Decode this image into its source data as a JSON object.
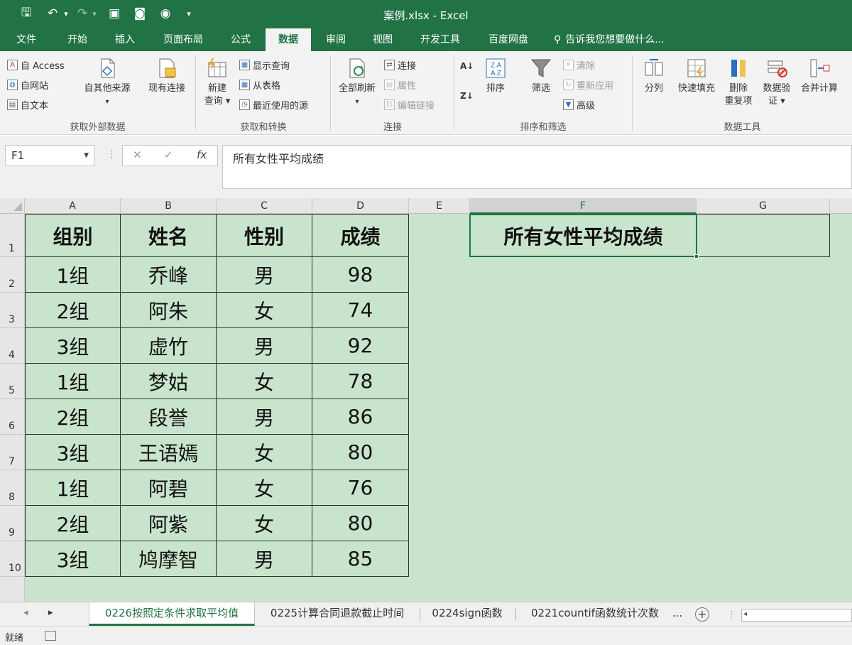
{
  "app": {
    "title": "案例.xlsx - Excel",
    "qat": {
      "save": "🖫",
      "undo": "↶",
      "undo_dd": "▾",
      "redo": "↷",
      "redo_dd": "▾",
      "extra": [
        "▣",
        "◙",
        "◉"
      ],
      "customize": "▾"
    }
  },
  "tabs": [
    "文件",
    "开始",
    "插入",
    "页面布局",
    "公式",
    "数据",
    "审阅",
    "视图",
    "开发工具",
    "百度网盘"
  ],
  "active_tab": "数据",
  "tell_me": "告诉我您想要做什么...",
  "ribbon": {
    "get_external": {
      "label": "获取外部数据",
      "items": [
        "自 Access",
        "自网站",
        "自文本"
      ],
      "other_sources": "自其他来源",
      "other_dd": "▾",
      "existing": "现有连接"
    },
    "transform": {
      "label": "获取和转换",
      "new_query": "新建",
      "new_query2": "查询 ▾",
      "items": [
        "显示查询",
        "从表格",
        "最近使用的源"
      ]
    },
    "connections": {
      "label": "连接",
      "refresh_all": "全部刷新",
      "refresh_dd": "▾",
      "items": [
        "连接",
        "属性",
        "编辑链接"
      ]
    },
    "sort_filter": {
      "label": "排序和筛选",
      "sort": "排序",
      "filter": "筛选",
      "items": [
        "清除",
        "重新应用",
        "高级"
      ]
    },
    "data_tools": {
      "label": "数据工具",
      "split": "分列",
      "flash_fill": "快速填充",
      "remove_dup": "删除",
      "remove_dup2": "重复项",
      "validation": "数据验",
      "validation2": "证 ▾",
      "consolidate": "合并计算"
    }
  },
  "formula_bar": {
    "name_box": "F1",
    "cancel": "✕",
    "enter": "✓",
    "fx": "fx",
    "content": "所有女性平均成绩"
  },
  "grid": {
    "columns": [
      "A",
      "B",
      "C",
      "D",
      "E",
      "F",
      "G"
    ],
    "selected_column": "F",
    "rows": [
      "1",
      "2",
      "3",
      "4",
      "5",
      "6",
      "7",
      "8",
      "9",
      "10",
      ""
    ],
    "headers": [
      "组别",
      "姓名",
      "性别",
      "成绩"
    ],
    "data": [
      [
        "1组",
        "乔峰",
        "男",
        "98"
      ],
      [
        "2组",
        "阿朱",
        "女",
        "74"
      ],
      [
        "3组",
        "虚竹",
        "男",
        "92"
      ],
      [
        "1组",
        "梦姑",
        "女",
        "78"
      ],
      [
        "2组",
        "段誉",
        "男",
        "86"
      ],
      [
        "3组",
        "王语嫣",
        "女",
        "80"
      ],
      [
        "1组",
        "阿碧",
        "女",
        "76"
      ],
      [
        "2组",
        "阿紫",
        "女",
        "80"
      ],
      [
        "3组",
        "鸠摩智",
        "男",
        "85"
      ]
    ],
    "f1": "所有女性平均成绩"
  },
  "sheets": {
    "nav_prev": "◂",
    "nav_next": "▸",
    "tabs": [
      "0226按照定条件求取平均值",
      "0225计算合同退款截止时间",
      "0224sign函数",
      "0221countif函数统计次数"
    ],
    "more": "...",
    "add": "+"
  },
  "status": {
    "ready": "就绪"
  }
}
